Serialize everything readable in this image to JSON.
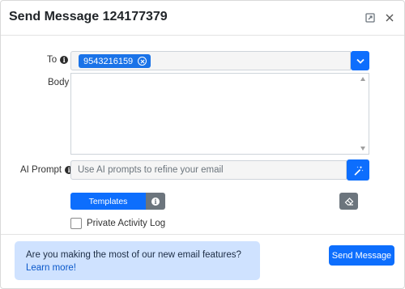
{
  "header": {
    "title": "Send Message 124177379",
    "expand_icon": "expand-icon",
    "close_icon": "close-icon"
  },
  "to": {
    "label": "To",
    "info_icon": "info-icon",
    "recipients": [
      "9543216159"
    ],
    "dropdown_icon": "chevron-down-icon"
  },
  "body": {
    "label": "Body",
    "value": ""
  },
  "ai": {
    "label": "AI Prompt",
    "placeholder": "Use AI prompts to refine your email",
    "button_icon": "magic-wand-icon"
  },
  "templates": {
    "label": "Templates",
    "info_icon": "info-icon",
    "eraser_icon": "eraser-icon"
  },
  "activity": {
    "label": "Private Activity Log",
    "checked": false
  },
  "footer": {
    "notice_text": "Are you making the most of our new email features? ",
    "notice_link": "Learn more!",
    "send_label": "Send Message"
  },
  "colors": {
    "primary": "#0d6efd",
    "secondary": "#6c757d",
    "notice_bg": "#cfe2ff"
  }
}
